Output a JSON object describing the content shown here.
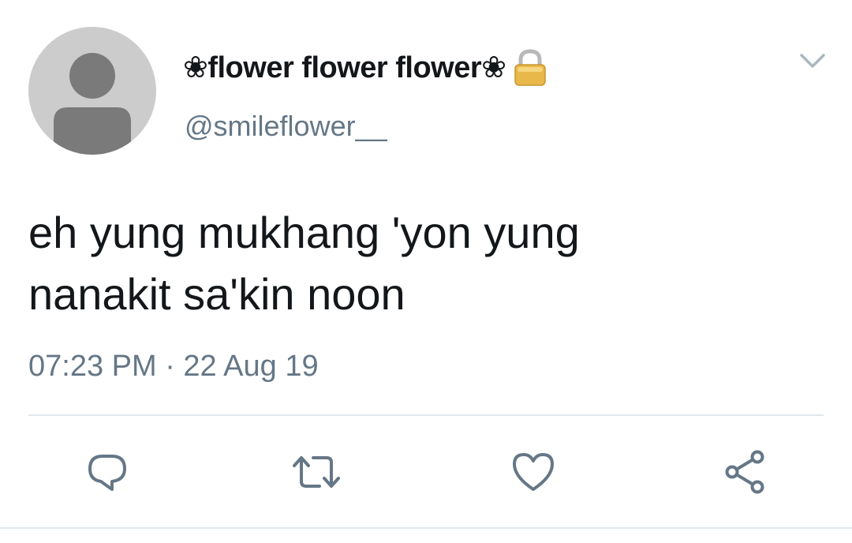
{
  "tweet": {
    "display_name": "❀flower flower flower❀",
    "handle": "@smileflower__",
    "text": "eh yung mukhang 'yon yung\nnanakit sa'kin noon",
    "timestamp": "07:23 PM · 22 Aug 19",
    "protected_icon": "lock-icon",
    "menu_icon": "chevron-down-icon"
  },
  "actions": {
    "reply_icon": "reply-icon",
    "retweet_icon": "retweet-icon",
    "like_icon": "heart-icon",
    "share_icon": "share-icon"
  },
  "colors": {
    "text_primary": "#14171a",
    "text_secondary": "#657786",
    "avatar_bg": "#cccccc",
    "avatar_figure": "#7a7a7a",
    "divider": "#e1e8ed",
    "lock_gold": "#e8b84a"
  }
}
